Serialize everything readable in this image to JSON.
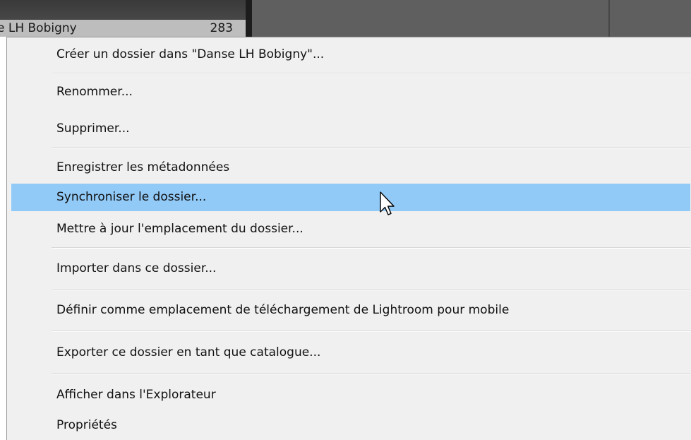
{
  "folder_panel": {
    "folder_name": "e LH Bobigny",
    "photo_count": "283"
  },
  "context_menu": {
    "items": [
      {
        "label": "Créer un dossier dans \"Danse LH Bobigny\"..."
      },
      {
        "label": "Renommer..."
      },
      {
        "label": "Supprimer..."
      },
      {
        "label": "Enregistrer les métadonnées"
      },
      {
        "label": "Synchroniser le dossier...",
        "highlighted": true
      },
      {
        "label": "Mettre à jour l'emplacement du dossier..."
      },
      {
        "label": "Importer dans ce dossier..."
      },
      {
        "label": "Définir comme emplacement de téléchargement de Lightroom pour mobile"
      },
      {
        "label": "Exporter ce dossier en tant que catalogue..."
      },
      {
        "label": "Afficher dans l'Explorateur"
      },
      {
        "label": "Propriétés"
      }
    ],
    "highlight_color": "#91c9f7",
    "background_color": "#f0f0f0"
  },
  "cursor": {
    "icon": "arrow-pointer-icon"
  }
}
